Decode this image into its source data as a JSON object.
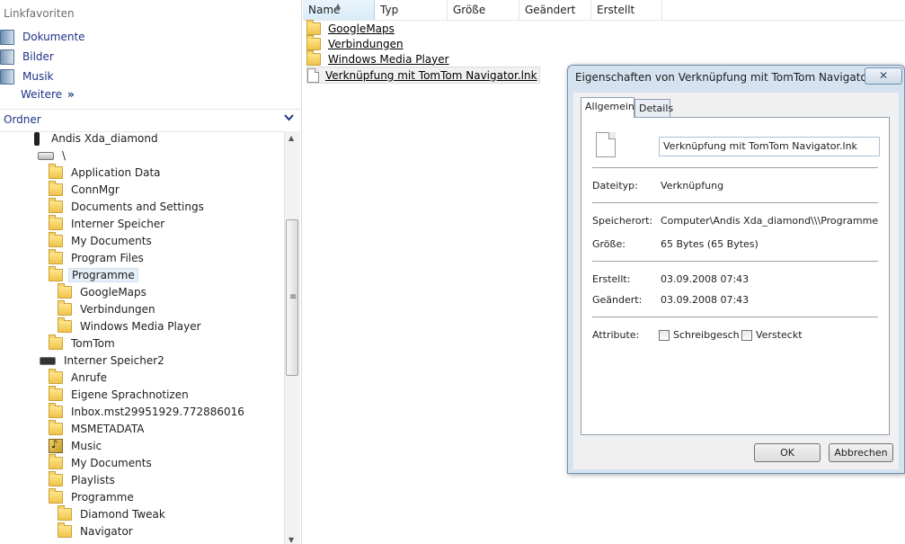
{
  "nav": {
    "favorites_title": "Linkfavoriten",
    "favorites": [
      {
        "label": "Dokumente",
        "icon": "documents-library-icon"
      },
      {
        "label": "Bilder",
        "icon": "pictures-library-icon"
      },
      {
        "label": "Musik",
        "icon": "music-library-icon"
      }
    ],
    "more_label": "Weitere",
    "more_chevron": "»",
    "folders_title": "Ordner",
    "tree": [
      {
        "label": "Andis Xda_diamond"
      },
      {
        "label": "\\"
      },
      {
        "label": "Application Data"
      },
      {
        "label": "ConnMgr"
      },
      {
        "label": "Documents and Settings"
      },
      {
        "label": "Interner Speicher"
      },
      {
        "label": "My Documents"
      },
      {
        "label": "Program Files"
      },
      {
        "label": "Programme"
      },
      {
        "label": "GoogleMaps"
      },
      {
        "label": "Verbindungen"
      },
      {
        "label": "Windows Media Player"
      },
      {
        "label": "TomTom"
      },
      {
        "label": "Interner Speicher2"
      },
      {
        "label": "Anrufe"
      },
      {
        "label": "Eigene Sprachnotizen"
      },
      {
        "label": "Inbox.mst29951929.772886016"
      },
      {
        "label": "MSMETADATA"
      },
      {
        "label": "Music"
      },
      {
        "label": "My Documents"
      },
      {
        "label": "Playlists"
      },
      {
        "label": "Programme"
      },
      {
        "label": "Diamond Tweak"
      },
      {
        "label": "Navigator"
      }
    ]
  },
  "list": {
    "columns": [
      "Name",
      "Typ",
      "Größe",
      "Geändert",
      "Erstellt"
    ],
    "items": [
      {
        "label": "GoogleMaps"
      },
      {
        "label": "Verbindungen"
      },
      {
        "label": "Windows Media Player"
      },
      {
        "label": "Verknüpfung mit TomTom Navigator.lnk"
      }
    ]
  },
  "dialog": {
    "title": "Eigenschaften von Verknüpfung mit TomTom Navigator.lnk",
    "close_glyph": "✕",
    "tabs": [
      "Allgemein",
      "Details"
    ],
    "name_value": "Verknüpfung mit TomTom Navigator.lnk",
    "dateityp_label": "Dateityp:",
    "dateityp_value": "Verknüpfung",
    "speicherort_label": "Speicherort:",
    "speicherort_value": "Computer\\Andis Xda_diamond\\\\\\Programme",
    "groesse_label": "Größe:",
    "groesse_value": "65 Bytes (65 Bytes)",
    "erstellt_label": "Erstellt:",
    "erstellt_value": "03.09.2008 07:43",
    "geaendert_label": "Geändert:",
    "geaendert_value": "03.09.2008 07:43",
    "attribute_label": "Attribute:",
    "readonly_label": "Schreibgesch",
    "hidden_label": "Versteckt",
    "ok_label": "OK",
    "cancel_label": "Abbrechen"
  }
}
